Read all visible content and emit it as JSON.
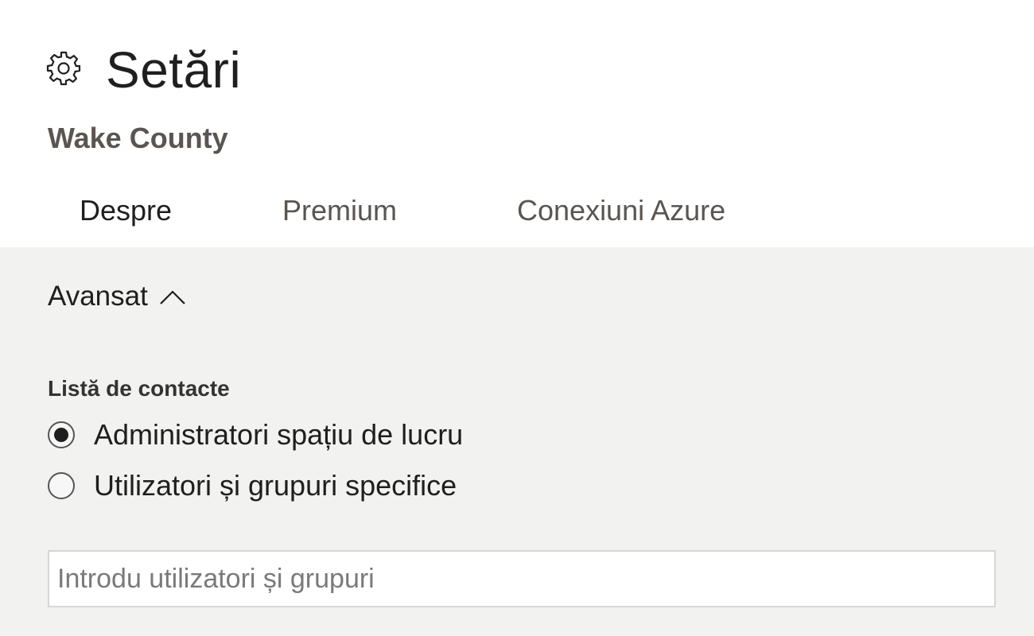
{
  "header": {
    "icon": "gear-icon",
    "title": "Setări",
    "subtitle": "Wake County"
  },
  "tabs": [
    {
      "label": "Despre",
      "selected": true
    },
    {
      "label": "Premium",
      "selected": false
    },
    {
      "label": "Conexiuni Azure",
      "selected": false
    }
  ],
  "advanced": {
    "label": "Avansat",
    "expanded": true,
    "icon": "chevron-up-icon"
  },
  "contact_list": {
    "label": "Listă de contacte",
    "options": [
      {
        "label": "Administratori spațiu de lucru",
        "checked": true
      },
      {
        "label": "Utilizatori și grupuri specifice",
        "checked": false
      }
    ],
    "input": {
      "value": "",
      "placeholder": "Introdu utilizatori și grupuri"
    }
  },
  "colors": {
    "page_background": "#f2f2f1",
    "header_background": "#ffffff",
    "primary_text": "#1f1f1f",
    "secondary_text": "#5a5551"
  }
}
